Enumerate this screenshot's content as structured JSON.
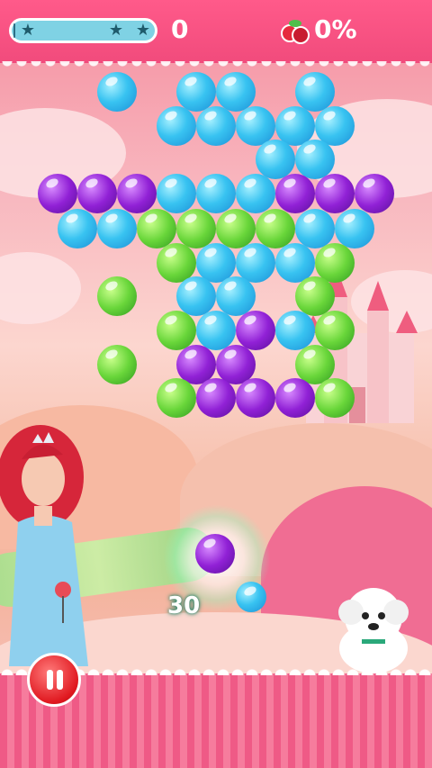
{
  "hud": {
    "score": "0",
    "percent": "0%",
    "progress_fraction": 0.0,
    "stars": [
      "star-icon",
      "star-icon",
      "star-icon"
    ],
    "colors": {
      "bar": "#ff5a8a",
      "progress_track": "#7fd2e4",
      "progress_fill": "#2c6f86"
    }
  },
  "launcher": {
    "shots_left": "30",
    "current_bubble": "purple",
    "next_bubble": "blue"
  },
  "board": {
    "colors": {
      "blue": "#38c3f1",
      "purple": "#9121d6",
      "green": "#69d63a"
    },
    "rows": [
      [
        "blue",
        "empty",
        "blue",
        "blue",
        "empty",
        "blue",
        "empty",
        "empty"
      ],
      [
        "empty",
        "blue",
        "blue",
        "blue",
        "blue",
        "blue",
        "empty",
        "empty"
      ],
      [
        "empty",
        "empty",
        "blue",
        "blue",
        "empty",
        "empty",
        "empty",
        "empty"
      ],
      [
        "purple",
        "purple",
        "purple",
        "blue",
        "blue",
        "blue",
        "purple",
        "purple",
        "purple"
      ],
      [
        "blue",
        "blue",
        "green",
        "green",
        "green",
        "green",
        "blue",
        "blue"
      ],
      [
        "empty",
        "green",
        "blue",
        "blue",
        "blue",
        "green",
        "empty",
        "empty"
      ],
      [
        "green",
        "empty",
        "blue",
        "blue",
        "empty",
        "green",
        "empty",
        "empty"
      ],
      [
        "empty",
        "green",
        "blue",
        "purple",
        "blue",
        "green",
        "empty",
        "empty"
      ],
      [
        "green",
        "empty",
        "purple",
        "purple",
        "empty",
        "green",
        "empty",
        "empty"
      ],
      [
        "empty",
        "green",
        "purple",
        "purple",
        "purple",
        "green",
        "empty",
        "empty"
      ]
    ]
  },
  "controls": {
    "pause_icon": "pause-icon"
  }
}
